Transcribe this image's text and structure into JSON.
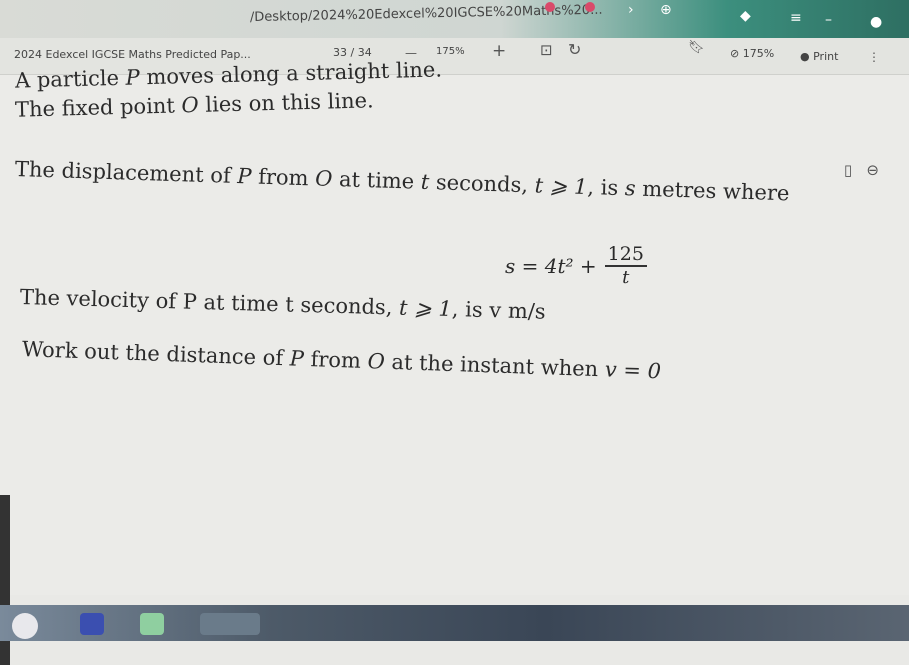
{
  "browser": {
    "url": "/Desktop/2024%20Edexcel%20IGCSE%20Maths%20..."
  },
  "pdf_toolbar": {
    "doc_title": "2024 Edexcel IGCSE Maths Predicted Pap...",
    "page_indicator": "33 / 34",
    "zoom_minus": "—",
    "zoom_level": "175%",
    "zoom_plus": "+",
    "zoom_readout": "175%",
    "print_label": "Print"
  },
  "question": {
    "line1_pre": "A particle ",
    "line1_var": "P",
    "line1_post": " moves along a straight line.",
    "line2_pre": "The fixed point ",
    "line2_var": "O",
    "line2_post": " lies on this line.",
    "line3_a": "The displacement of ",
    "line3_b": "P",
    "line3_c": " from ",
    "line3_d": "O",
    "line3_e": " at time ",
    "line3_f": "t",
    "line3_g": " seconds, ",
    "line3_h": "t ⩾ 1",
    "line3_i": ", is ",
    "line3_j": "s",
    "line3_k": " metres where",
    "formula_lhs": "s = 4t² + ",
    "formula_num": "125",
    "formula_den": "t",
    "line4": "The velocity of P at time t seconds, ",
    "line4_cond": "t ⩾ 1",
    "line4_post": ", is v m/s",
    "line5_pre": "Work out the distance of ",
    "line5_p": "P",
    "line5_mid": " from ",
    "line5_o": "O",
    "line5_post": " at the instant when ",
    "line5_cond": "v = 0"
  }
}
